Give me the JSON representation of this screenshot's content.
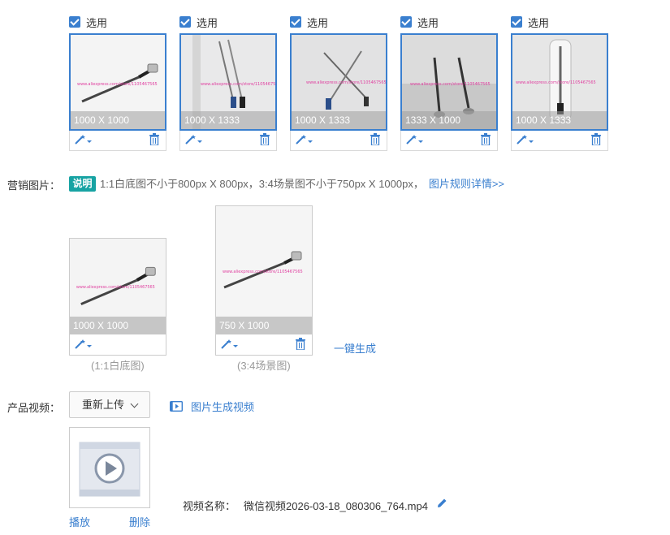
{
  "gallery": {
    "select_label": "选用",
    "items": [
      {
        "dims": "1000 X 1000",
        "selected": true
      },
      {
        "dims": "1000 X 1333",
        "selected": true
      },
      {
        "dims": "1000 X 1333",
        "selected": true
      },
      {
        "dims": "1333 X 1000",
        "selected": true
      },
      {
        "dims": "1000 X 1333",
        "selected": true
      }
    ]
  },
  "marketing": {
    "label": "营销图片：",
    "badge": "说明",
    "hint": "1:1白底图不小于800px X 800px，3:4场景图不小于750px X 1000px，",
    "rules_link": "图片规则详情>>",
    "square": {
      "dims": "1000 X 1000",
      "caption": "(1:1白底图)"
    },
    "scene": {
      "dims": "750 X 1000",
      "caption": "(3:4场景图)"
    },
    "generate_label": "一键生成"
  },
  "video": {
    "label": "产品视频：",
    "reupload_label": "重新上传",
    "gen_video_label": "图片生成视频",
    "play_label": "播放",
    "delete_label": "删除",
    "name_label": "视频名称：",
    "name_value": "微信视频2026-03-18_080306_764.mp4"
  },
  "watermark": "www.aliexpress.com/store/1105467565",
  "colors": {
    "accent": "#3a7fcf",
    "badge": "#17a3a3"
  }
}
